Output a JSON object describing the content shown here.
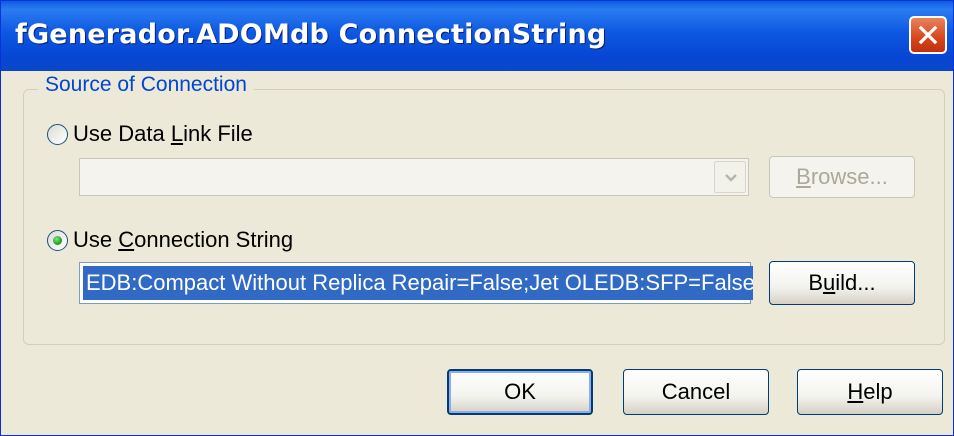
{
  "window": {
    "title": "fGenerador.ADOMdb ConnectionString"
  },
  "source_group": {
    "legend": "Source of Connection",
    "data_link": {
      "label_before": "Use Data ",
      "label_mnemonic": "L",
      "label_after": "ink File",
      "selected": false,
      "combo_value": "",
      "browse_mnemonic": "B",
      "browse_rest": "rowse...",
      "browse_enabled": false
    },
    "connection_string": {
      "label_before": "Use ",
      "label_mnemonic": "C",
      "label_after": "onnection String",
      "selected": true,
      "value": "EDB:Compact Without Replica Repair=False;Jet OLEDB:SFP=False",
      "build_before": "B",
      "build_mnemonic": "u",
      "build_after": "ild..."
    }
  },
  "footer": {
    "ok_label": "OK",
    "cancel_label": "Cancel",
    "help_mnemonic": "H",
    "help_rest": "elp"
  },
  "colors": {
    "titlebar": "#0a5ce0",
    "close": "#d6451d",
    "dialog_bg": "#ece9d8",
    "selection": "#316ac5",
    "legend_text": "#0046d5",
    "radio_dot": "#21a121"
  }
}
